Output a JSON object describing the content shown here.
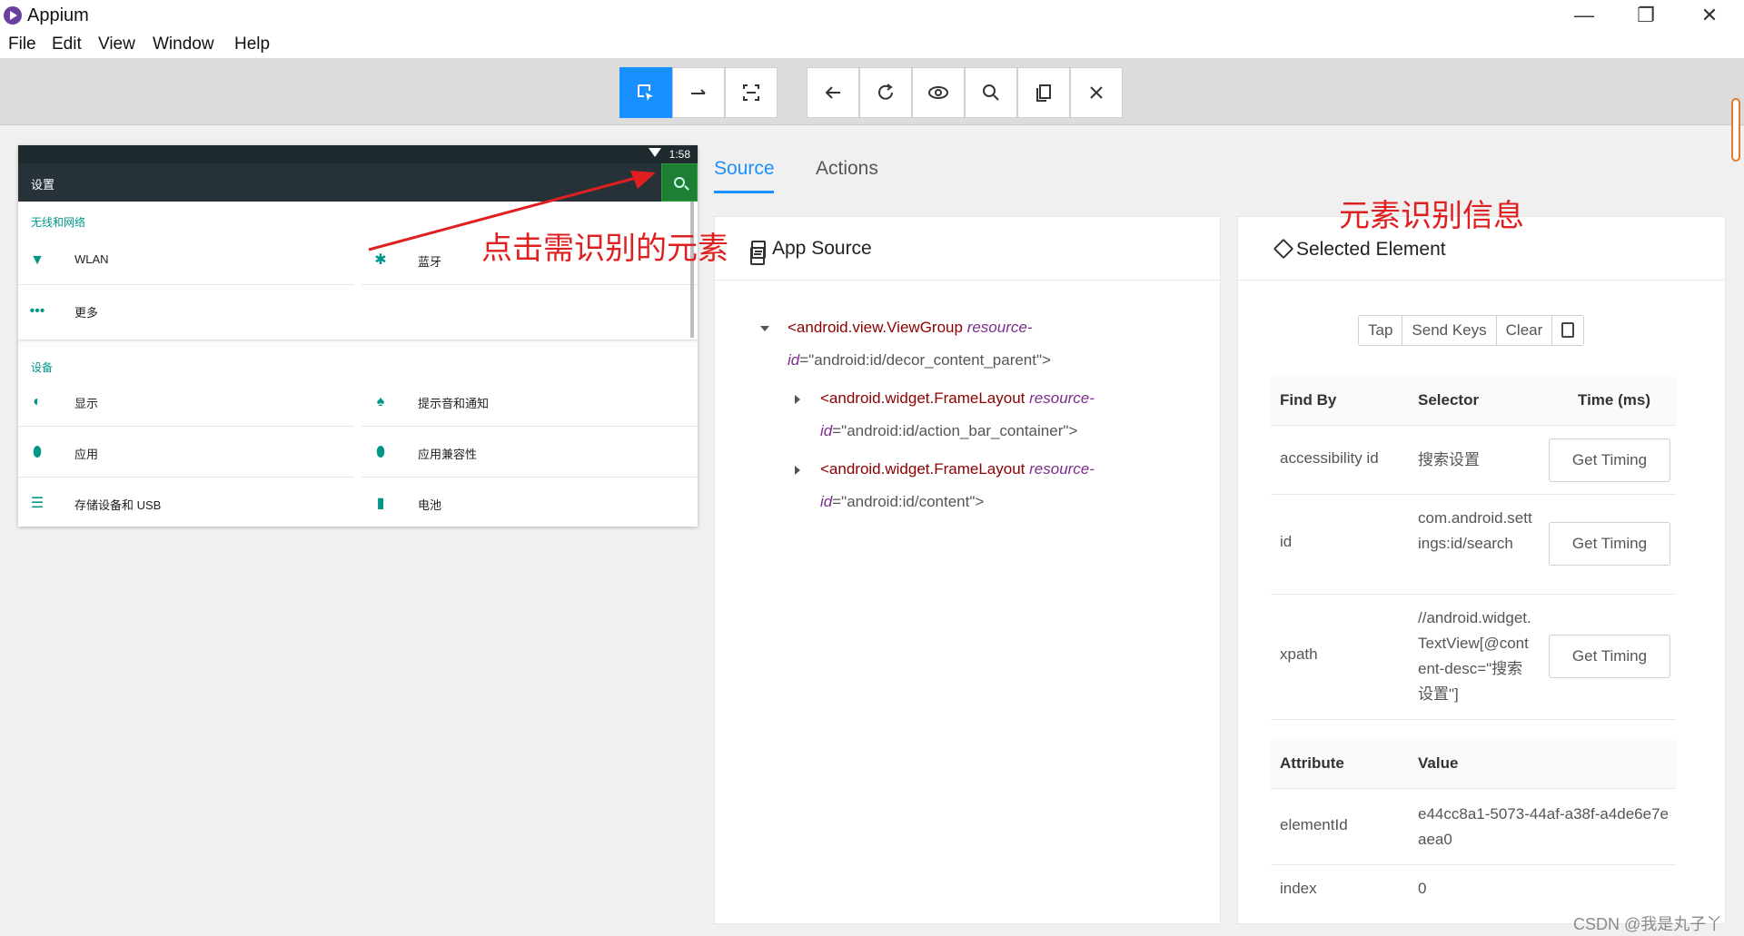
{
  "window": {
    "title": "Appium",
    "controls": {
      "minimize": "—",
      "maximize": "❐",
      "close": "✕"
    }
  },
  "menu": [
    "File",
    "Edit",
    "View",
    "Window",
    "Help"
  ],
  "toolbar": {
    "group1": [
      "select-element-icon",
      "swipe-icon",
      "tap-coordinates-icon"
    ],
    "group2": [
      "back-icon",
      "refresh-icon",
      "show-eye-icon",
      "search-icon",
      "copy-xml-icon",
      "quit-session-icon"
    ]
  },
  "device": {
    "status_time": "1:58",
    "action_title": "设置",
    "section1_title": "无线和网络",
    "section1_items": [
      "WLAN",
      "蓝牙",
      "更多"
    ],
    "section2_title": "设备",
    "section2_items": [
      "显示",
      "提示音和通知",
      "应用",
      "应用兼容性",
      "存储设备和 USB",
      "电池"
    ],
    "icons": {
      "wlan": "▼",
      "bt": "✱",
      "more": "•••",
      "display": "◐",
      "notify": "♠",
      "app": "⬮",
      "compat": "⬮",
      "storage": "☰",
      "battery": "▮"
    }
  },
  "tabs": {
    "source": "Source",
    "actions": "Actions"
  },
  "source_panel": {
    "title": "App Source",
    "nodes": [
      {
        "tag": "<android.view.ViewGroup",
        "attr": "resource-",
        "attr2": "id",
        "value": "=\"android:id/decor_content_parent\">"
      },
      {
        "tag": "<android.widget.FrameLayout",
        "attr": "resource-",
        "attr2": "id",
        "value": "=\"android:id/action_bar_container\">"
      },
      {
        "tag": "<android.widget.FrameLayout",
        "attr": "resource-",
        "attr2": "id",
        "value": "=\"android:id/content\">"
      }
    ]
  },
  "selected_panel": {
    "title": "Selected Element",
    "buttons": [
      "Tap",
      "Send Keys",
      "Clear"
    ],
    "find_table": {
      "headers": [
        "Find By",
        "Selector",
        "Time (ms)"
      ],
      "rows": [
        {
          "by": "accessibility id",
          "selector": "搜索设置",
          "action": "Get Timing"
        },
        {
          "by": "id",
          "selector": "com.android.settings:id/search",
          "action": "Get Timing"
        },
        {
          "by": "xpath",
          "selector": "//android.widget.TextView[@content-desc=\"搜索设置\"]",
          "action": "Get Timing"
        }
      ]
    },
    "attr_table": {
      "headers": [
        "Attribute",
        "Value"
      ],
      "rows": [
        {
          "name": "elementId",
          "value": "e44cc8a1-5073-44af-a38f-a4de6e7eaea0"
        },
        {
          "name": "index",
          "value": "0"
        }
      ]
    }
  },
  "annotations": {
    "click_hint": "点击需识别的元素",
    "info_hint": "元素识别信息"
  },
  "watermark": "CSDN @我是丸子丫"
}
